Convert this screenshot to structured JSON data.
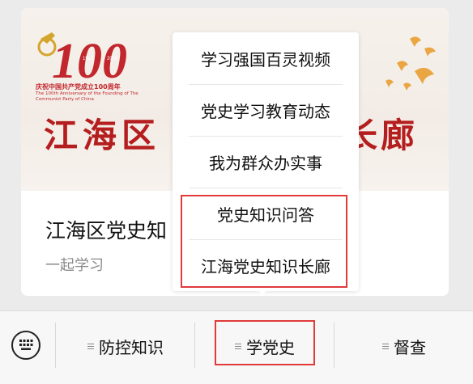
{
  "article": {
    "banner": {
      "logo_number": "100",
      "logo_years": [
        "1921",
        "2021"
      ],
      "logo_caption_cn": "庆祝中国共产党成立100周年",
      "logo_caption_en": "The 100th Anniversary of the Founding of The Communist Party of China",
      "title_left": "江海区",
      "title_right": "长廊"
    },
    "title": "江海区党史知",
    "subtitle": "一起学习"
  },
  "popup_menu": {
    "items": [
      {
        "label": "学习强国百灵视频"
      },
      {
        "label": "党史学习教育动态"
      },
      {
        "label": "我为群众办实事"
      },
      {
        "label": "党史知识问答"
      },
      {
        "label": "江海党史知识长廊"
      }
    ]
  },
  "bottom_bar": {
    "tabs": [
      {
        "label": "防控知识"
      },
      {
        "label": "学党史"
      },
      {
        "label": "督查"
      }
    ]
  },
  "colors": {
    "highlight": "#e03a3a",
    "banner_red": "#b51e1e"
  }
}
